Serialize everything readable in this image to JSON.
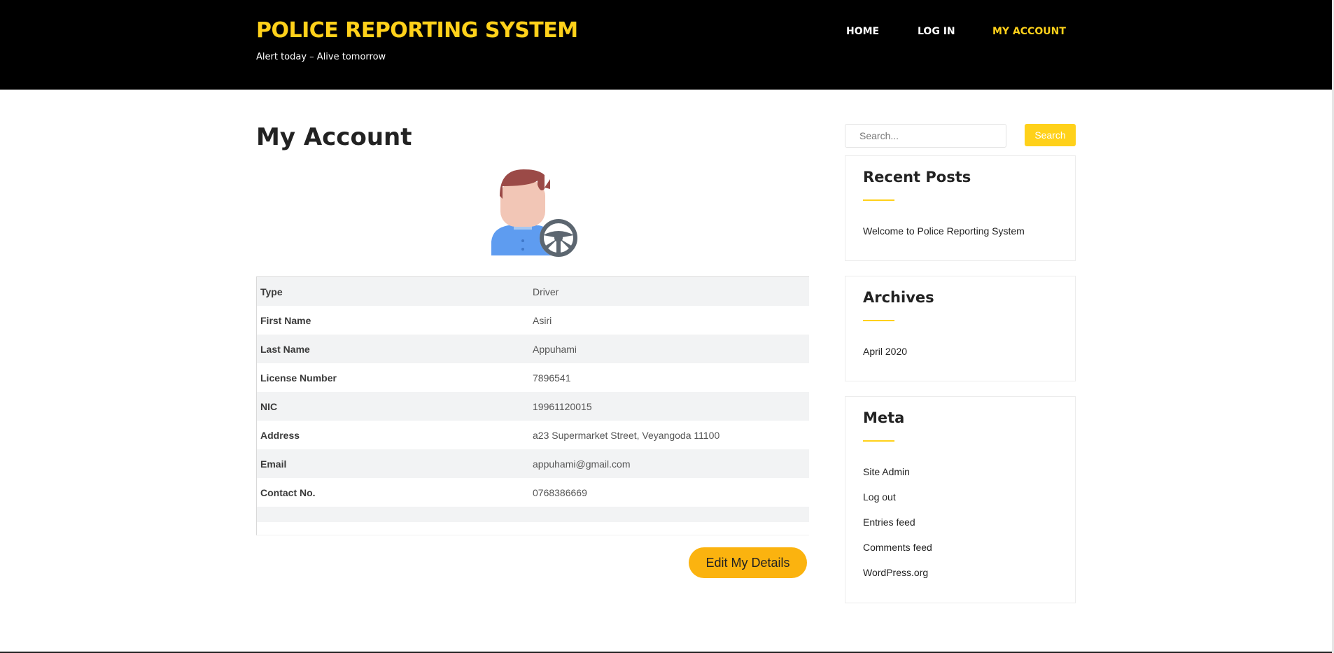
{
  "header": {
    "site_title": "POLICE REPORTING SYSTEM",
    "tagline": "Alert today – Alive tomorrow",
    "nav": [
      {
        "label": "HOME"
      },
      {
        "label": "LOG IN"
      },
      {
        "label": "MY ACCOUNT",
        "active": true
      }
    ]
  },
  "main": {
    "page_title": "My Account",
    "avatar_icon": "driver-avatar-icon",
    "details": [
      {
        "label": "Type",
        "value": "Driver"
      },
      {
        "label": "First Name",
        "value": "Asiri"
      },
      {
        "label": "Last Name",
        "value": "Appuhami"
      },
      {
        "label": "License Number",
        "value": "7896541"
      },
      {
        "label": "NIC",
        "value": "19961120015"
      },
      {
        "label": "Address",
        "value": "a23 Supermarket Street, Veyangoda 11100"
      },
      {
        "label": "Email",
        "value": "appuhami@gmail.com"
      },
      {
        "label": "Contact No.",
        "value": "0768386669"
      }
    ],
    "edit_button": "Edit My Details"
  },
  "sidebar": {
    "search_placeholder": "Search...",
    "search_button": "Search",
    "recent_posts": {
      "title": "Recent Posts",
      "items": [
        "Welcome to Police Reporting System"
      ]
    },
    "archives": {
      "title": "Archives",
      "items": [
        "April 2020"
      ]
    },
    "meta": {
      "title": "Meta",
      "items": [
        "Site Admin",
        "Log out",
        "Entries feed",
        "Comments feed",
        "WordPress.org"
      ]
    }
  },
  "colors": {
    "header_bg": "#000000",
    "accent": "#ffd11a",
    "button": "#fbb30f",
    "row_alt": "#f2f3f4"
  }
}
